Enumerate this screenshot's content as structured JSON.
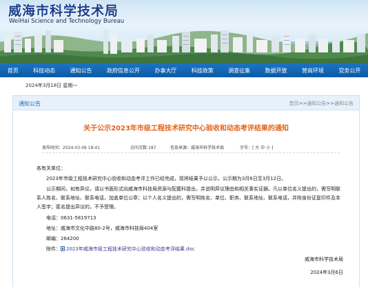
{
  "header": {
    "title_cn": "威海市科学技术局",
    "title_en": "WeiHai Science and Technology Bureau"
  },
  "nav": [
    "首页",
    "科技动态",
    "通知公告",
    "政府信息公开",
    "办事大厅",
    "科技政策",
    "调查征集",
    "数据开放",
    "营商环境",
    "党务公开"
  ],
  "date_line": "2024年3月18日 星期一",
  "section": {
    "title": "通知公告",
    "breadcrumbs": [
      "首页",
      "通知公告",
      "通知公告"
    ],
    "crumb_sep": ">>"
  },
  "article": {
    "title": "关于公示2023年市级工程技术研究中心验收和动态考评结果的通知",
    "published": "发布时间：2024-03-06 18:41",
    "views": "访问次数:187",
    "source": "信息来源：威海市科学技术局",
    "font_size": "字号：[ 大 中 小 ]",
    "salutation": "各有关单位：",
    "para1": "2023年市级工程技术研究中心验收和动态考评工作已经完成，现将结果予以公示。公示期为3月6日至3月12日。",
    "para2": "公示期间，如有异议，请以书面形式向威海市科技局资源与配置科提出，并说明异议理由和相关事实证据。凡以单位名义提出的，需写明联系人姓名、联系地址、联系电话，加盖单位公章；以个人名义提出的，需写明姓名、单位、职务、联系地址、联系电话，并附身份证复印件及本人签字；匿名提出异议的，不予受理。",
    "phone": "电话：0631-5819713",
    "address": "地址：威海市文化中路80-2号，威海市科技局404室",
    "postcode": "邮编：264200",
    "attachment_label": "附件：",
    "attachment_file": "2023年威海市级工程技术研究中心验收和动态考评结果.doc",
    "signature": "威海市科学技术局",
    "sign_date": "2024年3月6日"
  },
  "colors": {
    "nav": "#0a5aa6",
    "title": "#e2641b",
    "logo": "#1a3f8c"
  }
}
